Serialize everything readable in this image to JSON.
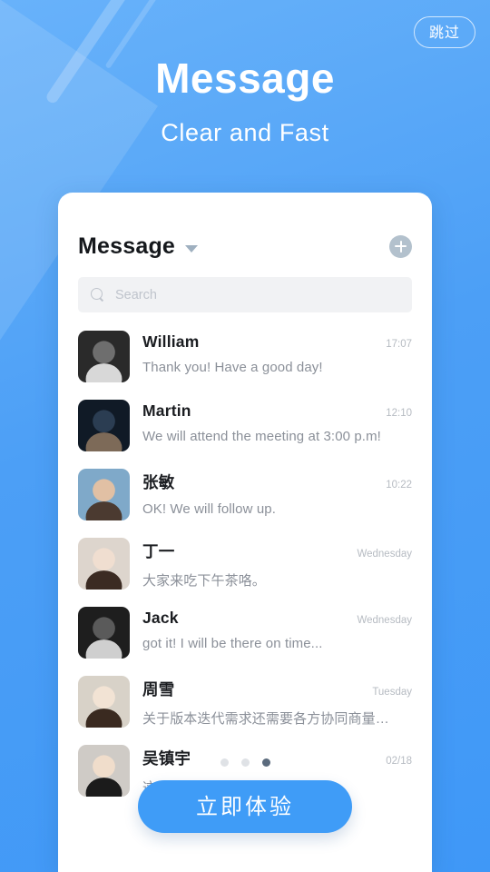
{
  "screen": {
    "background_top_color": "#68b2fa",
    "background_bottom_color": "#3f98f7"
  },
  "skip": {
    "label": "跳过"
  },
  "hero": {
    "title": "Message",
    "subtitle": "Clear and Fast"
  },
  "card": {
    "title": "Message",
    "chevron_icon": "chevron-down-icon",
    "add_icon": "plus-circle-icon",
    "search": {
      "icon": "search-icon",
      "placeholder": "Search",
      "value": ""
    },
    "conversations": [
      {
        "name": "William",
        "time": "17:07",
        "preview": "Thank you!  Have a good day!",
        "avatar": "photo-man-grayscale"
      },
      {
        "name": "Martin",
        "time": "12:10",
        "preview": "We will attend the meeting at 3:00 p.m!",
        "avatar": "photo-man-dark"
      },
      {
        "name": "张敏",
        "time": "10:22",
        "preview": "OK!  We will follow up.",
        "avatar": "photo-woman-outdoor"
      },
      {
        "name": "丁一",
        "time": "Wednesday",
        "preview": "大家来吃下午茶咯。",
        "avatar": "photo-woman-longhair"
      },
      {
        "name": "Jack",
        "time": "Wednesday",
        "preview": "got it!  I will be there on time...",
        "avatar": "photo-man-glasses"
      },
      {
        "name": "周雪",
        "time": "Tuesday",
        "preview": "关于版本迭代需求还需要各方协同商量…",
        "avatar": "photo-woman-beige"
      },
      {
        "name": "吴镇宇",
        "time": "02/18",
        "preview": "这个",
        "avatar": "photo-man-black-shirt"
      }
    ]
  },
  "pagination": {
    "total": 3,
    "active_index": 2,
    "active_color": "#5b6b7d",
    "inactive_color": "#dfe2e6"
  },
  "cta": {
    "label": "立即体验",
    "color": "#3f9cf7"
  }
}
